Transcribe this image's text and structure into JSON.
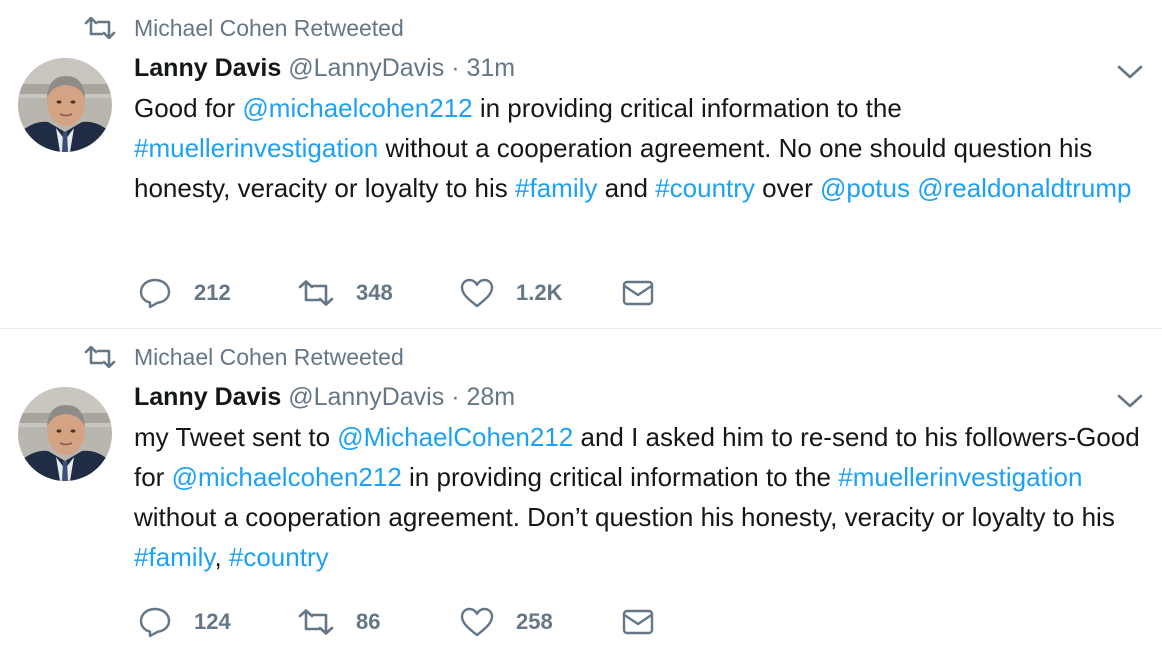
{
  "tweets": [
    {
      "retweeted_by": "Michael Cohen Retweeted",
      "author_name": "Lanny Davis",
      "author_handle": "@LannyDavis",
      "separator": "·",
      "time": "31m",
      "text_segments": [
        {
          "t": "Good for ",
          "link": false
        },
        {
          "t": "@michaelcohen212",
          "link": true
        },
        {
          "t": " in providing critical information to the ",
          "link": false
        },
        {
          "t": "#muellerinvestigation",
          "link": true
        },
        {
          "t": " without a cooperation agreement. No one should question his honesty, veracity or loyalty to his ",
          "link": false
        },
        {
          "t": "#family",
          "link": true
        },
        {
          "t": " and ",
          "link": false
        },
        {
          "t": "#country",
          "link": true
        },
        {
          "t": " over ",
          "link": false
        },
        {
          "t": "@potus",
          "link": true
        },
        {
          "t": " ",
          "link": false
        },
        {
          "t": "@realdonaldtrump",
          "link": true
        }
      ],
      "replies": "212",
      "retweets": "348",
      "likes": "1.2K"
    },
    {
      "retweeted_by": "Michael Cohen Retweeted",
      "author_name": "Lanny Davis",
      "author_handle": "@LannyDavis",
      "separator": "·",
      "time": "28m",
      "text_segments": [
        {
          "t": "my Tweet sent to ",
          "link": false
        },
        {
          "t": "@MichaelCohen212",
          "link": true
        },
        {
          "t": " and I asked him to re-send to his followers-Good for ",
          "link": false
        },
        {
          "t": "@michaelcohen212",
          "link": true
        },
        {
          "t": " in providing critical information to the ",
          "link": false
        },
        {
          "t": "#muellerinvestigation",
          "link": true
        },
        {
          "t": " without a cooperation agreement. Don’t question his honesty, veracity or loyalty to his ",
          "link": false
        },
        {
          "t": "#family",
          "link": true
        },
        {
          "t": ", ",
          "link": false
        },
        {
          "t": "#country",
          "link": true
        }
      ],
      "replies": "124",
      "retweets": "86",
      "likes": "258"
    }
  ],
  "icons": {
    "retweet_indicator": "retweet-icon",
    "reply": "reply-icon",
    "retweet": "retweet-icon",
    "like": "heart-icon",
    "dm": "envelope-icon",
    "more": "chevron-down-icon"
  },
  "colors": {
    "link": "#1da1f2",
    "muted": "#657786",
    "text": "#14171a",
    "divider": "#e6ecf0"
  }
}
